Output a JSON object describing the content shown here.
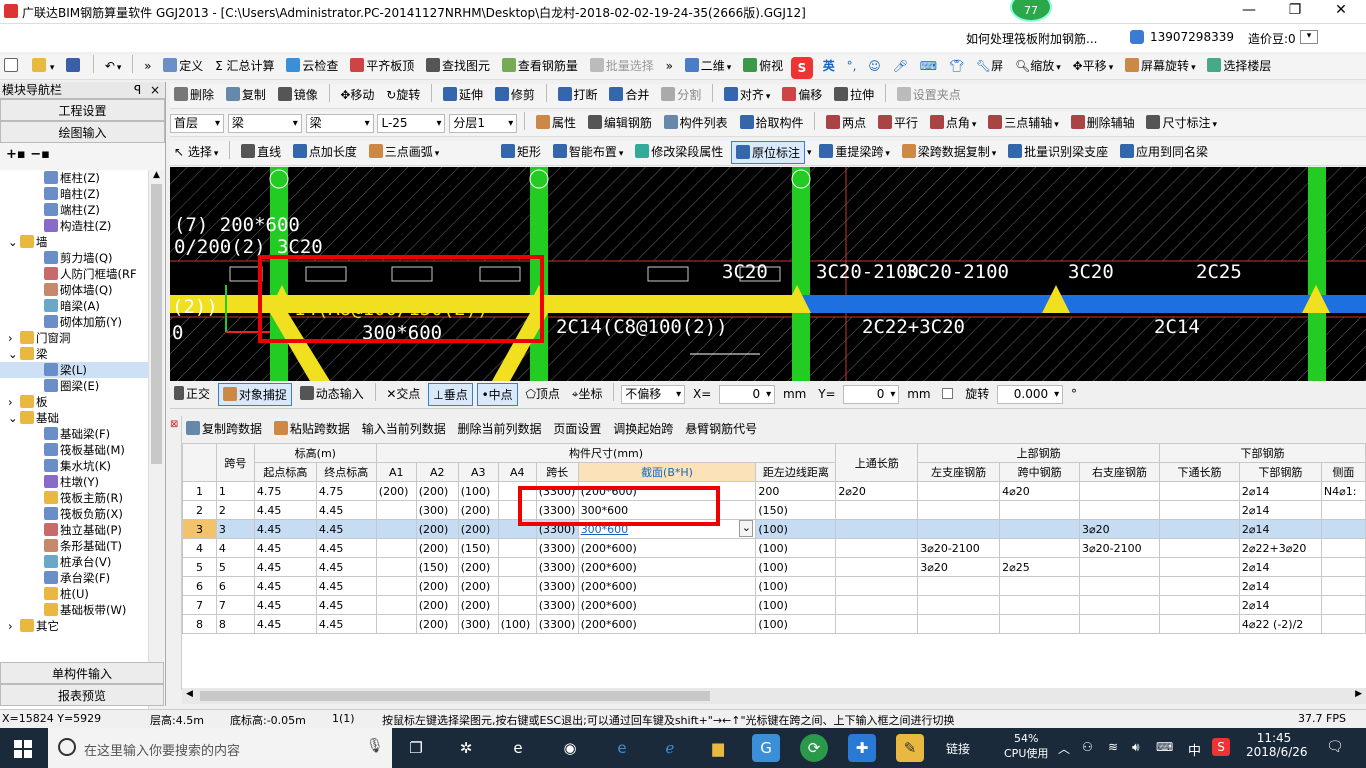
{
  "title_bar": {
    "text": "广联达BIM钢筋算量软件 GGJ2013 - [C:\\Users\\Administrator.PC-20141127NRHM\\Desktop\\白龙村-2018-02-02-19-24-35(2666版).GGJ12]",
    "badge": "77"
  },
  "info_bar": {
    "question": "如何处理筏板附加钢筋...",
    "phone": "13907298339",
    "bean": "造价豆:0"
  },
  "toolbar1": [
    "定义",
    "汇总计算",
    "云检查",
    "平齐板顶",
    "查找图元",
    "查看钢筋量",
    "批量选择",
    "二维",
    "俯视",
    "英",
    "屏",
    "缩放",
    "平移",
    "屏幕旋转",
    "选择楼层"
  ],
  "toolbar2": [
    "删除",
    "复制",
    "镜像",
    "移动",
    "旋转",
    "延伸",
    "修剪",
    "打断",
    "合并",
    "分割",
    "对齐",
    "偏移",
    "拉伸",
    "设置夹点"
  ],
  "toolbar3": {
    "floor": "首层",
    "cat": "梁",
    "type": "梁",
    "member": "L-25",
    "layer": "分层1",
    "items": [
      "属性",
      "编辑钢筋",
      "构件列表",
      "拾取构件",
      "两点",
      "平行",
      "点角",
      "三点辅轴",
      "删除辅轴",
      "尺寸标注"
    ]
  },
  "toolbar4": [
    "选择",
    "直线",
    "点加长度",
    "三点画弧",
    "矩形",
    "智能布置",
    "修改梁段属性",
    "原位标注",
    "重提梁跨",
    "梁跨数据复制",
    "批量识别梁支座",
    "应用到同名梁"
  ],
  "sidebar": {
    "header": "模块导航栏",
    "pin": "ꟼ",
    "close": "×",
    "btn_engineering": "工程设置",
    "btn_drawing": "绘图输入",
    "btn_single": "单构件输入",
    "btn_report": "报表预览",
    "tree": [
      "框柱(Z)",
      "暗柱(Z)",
      "端柱(Z)",
      "构造柱(Z)",
      "墙",
      "剪力墙(Q)",
      "人防门框墙(RF",
      "砌体墙(Q)",
      "暗梁(A)",
      "砌体加筋(Y)",
      "门窗洞",
      "梁",
      "梁(L)",
      "圈梁(E)",
      "板",
      "基础",
      "基础梁(F)",
      "筏板基础(M)",
      "集水坑(K)",
      "柱墩(Y)",
      "筏板主筋(R)",
      "筏板负筋(X)",
      "独立基础(P)",
      "条形基础(T)",
      "桩承台(V)",
      "承台梁(F)",
      "桩(U)",
      "基础板带(W)",
      "其它"
    ]
  },
  "canvas": {
    "labels": [
      "(7)  200*600",
      "0/200(2) 3C20",
      "3C20",
      "3C20-2100",
      "3C20-2100",
      "3C20",
      "2C25",
      "(2))",
      "14(A8@100/150(2))",
      "0",
      "300*600",
      "2C14(C8@100(2))",
      "2C22+3C20",
      "2C14"
    ]
  },
  "snap_bar": [
    "正交",
    "对象捕捉",
    "动态输入",
    "交点",
    "垂点",
    "中点",
    "顶点",
    "坐标",
    "不偏移"
  ],
  "snap_fields": {
    "x_label": "X=",
    "x_val": "0",
    "unit": "mm",
    "y_label": "Y=",
    "y_val": "0",
    "rot_label": "旋转",
    "rot_val": "0.000",
    "deg": "°"
  },
  "table_toolbar": [
    "复制跨数据",
    "粘贴跨数据",
    "输入当前列数据",
    "删除当前列数据",
    "页面设置",
    "调换起始跨",
    "悬臂钢筋代号"
  ],
  "table": {
    "h1": [
      "跨号",
      "标高(m)",
      "构件尺寸(mm)",
      "上通长筋",
      "上部钢筋",
      "下部钢筋"
    ],
    "h2": [
      "起点标高",
      "终点标高",
      "A1",
      "A2",
      "A3",
      "A4",
      "跨长",
      "截面(B*H)",
      "距左边线距离",
      "左支座钢筋",
      "跨中钢筋",
      "右支座钢筋",
      "下通长筋",
      "下部钢筋",
      "侧面"
    ],
    "rows": [
      [
        "1",
        "1",
        "4.75",
        "4.75",
        "(200)",
        "(200)",
        "(100)",
        "",
        "(3300)",
        "(200*600)",
        "200",
        "2⌀20",
        "",
        "4⌀20",
        "",
        "",
        "2⌀14",
        "N4⌀1:"
      ],
      [
        "2",
        "2",
        "4.45",
        "4.45",
        "",
        "(300)",
        "(200)",
        "",
        "(3300)",
        "300*600",
        "(150)",
        "",
        "",
        "",
        "",
        "",
        "2⌀14",
        ""
      ],
      [
        "3",
        "3",
        "4.45",
        "4.45",
        "",
        "(200)",
        "(200)",
        "",
        "(3300)",
        "300*600",
        "(100)",
        "",
        "",
        "",
        "3⌀20",
        "",
        "2⌀14",
        ""
      ],
      [
        "4",
        "4",
        "4.45",
        "4.45",
        "",
        "(200)",
        "(150)",
        "",
        "(3300)",
        "(200*600)",
        "(100)",
        "",
        "3⌀20-2100",
        "",
        "3⌀20-2100",
        "",
        "2⌀22+3⌀20",
        ""
      ],
      [
        "5",
        "5",
        "4.45",
        "4.45",
        "",
        "(150)",
        "(200)",
        "",
        "(3300)",
        "(200*600)",
        "(100)",
        "",
        "3⌀20",
        "2⌀25",
        "",
        "",
        "2⌀14",
        ""
      ],
      [
        "6",
        "6",
        "4.45",
        "4.45",
        "",
        "(200)",
        "(200)",
        "",
        "(3300)",
        "(200*600)",
        "(100)",
        "",
        "",
        "",
        "",
        "",
        "2⌀14",
        ""
      ],
      [
        "7",
        "7",
        "4.45",
        "4.45",
        "",
        "(200)",
        "(200)",
        "",
        "(3300)",
        "(200*600)",
        "(100)",
        "",
        "",
        "",
        "",
        "",
        "2⌀14",
        ""
      ],
      [
        "8",
        "8",
        "4.45",
        "4.45",
        "",
        "(200)",
        "(300)",
        "(100)",
        "(3300)",
        "(200*600)",
        "(100)",
        "",
        "",
        "",
        "",
        "",
        "4⌀22 (-2)/2",
        ""
      ]
    ]
  },
  "status": {
    "coords": "X=15824 Y=5929",
    "floor_h": "层高:4.5m",
    "base_h": "底标高:-0.05m",
    "count": "1(1)",
    "hint": "按鼠标左键选择梁图元,按右键或ESC退出;可以通过回车键及shift+\"→←↑\"光标键在跨之间、上下输入框之间进行切换",
    "fps": "37.7 FPS"
  },
  "taskbar": {
    "search": "在这里输入你要搜索的内容",
    "link": "链接",
    "cpu_pct": "54%",
    "cpu_lbl": "CPU使用",
    "ime": "中",
    "time": "11:45",
    "date": "2018/6/26"
  }
}
